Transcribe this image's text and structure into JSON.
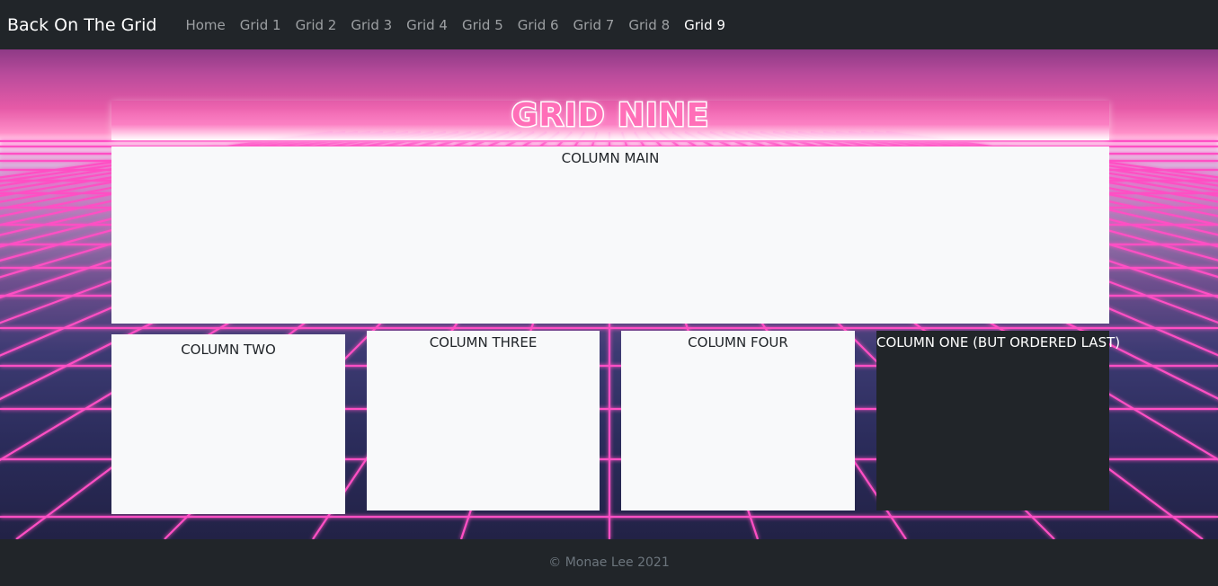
{
  "navbar": {
    "brand": "Back On The Grid",
    "links": [
      "Home",
      "Grid 1",
      "Grid 2",
      "Grid 3",
      "Grid 4",
      "Grid 5",
      "Grid 6",
      "Grid 7",
      "Grid 8",
      "Grid 9"
    ],
    "active": "Grid 9"
  },
  "hero": {
    "title": "GRID NINE",
    "grid_color": "#ff4fc4",
    "sky_color": "#8e3a86",
    "floor_color": "#2b2c5b"
  },
  "columns": {
    "main": "COLUMN MAIN",
    "two": "COLUMN TWO",
    "three": "COLUMN THREE",
    "four": "COLUMN FOUR",
    "one": "COLUMN ONE (BUT ORDERED LAST)"
  },
  "footer": {
    "text": "© Monae Lee 2021"
  }
}
